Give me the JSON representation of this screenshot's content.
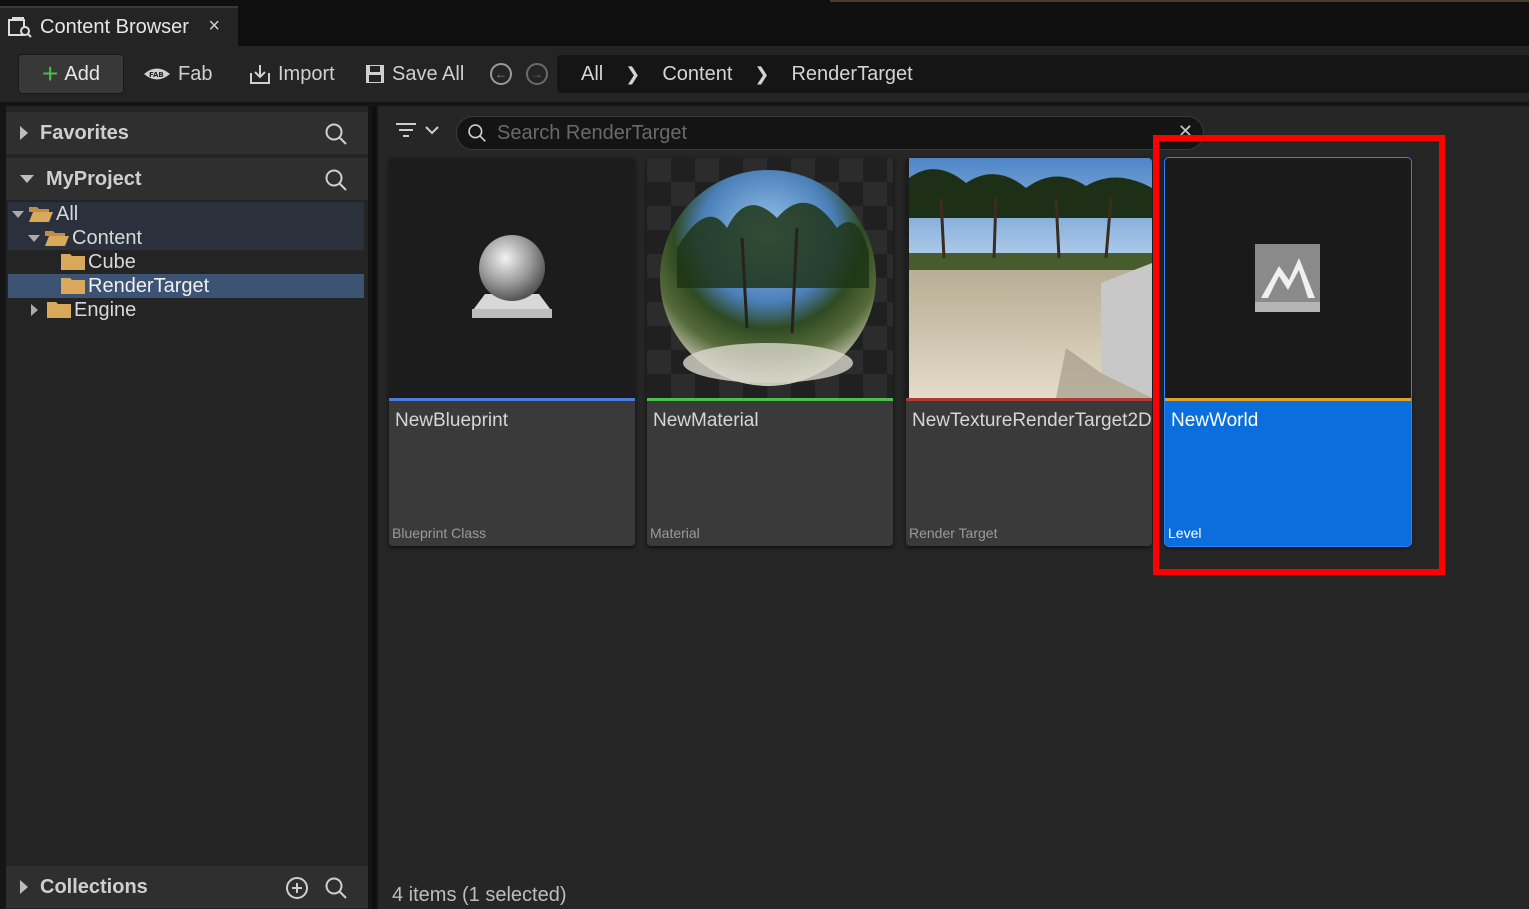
{
  "tab": {
    "title": "Content Browser",
    "close": "×",
    "icon": "content-browser-icon"
  },
  "toolbar": {
    "add_label": "Add",
    "fab_label": "Fab",
    "import_label": "Import",
    "save_all_label": "Save All",
    "back_icon": "back-arrow-icon",
    "forward_icon": "forward-arrow-icon"
  },
  "breadcrumb": [
    "All",
    "Content",
    "RenderTarget"
  ],
  "sidebar": {
    "favorites_label": "Favorites",
    "project_label": "MyProject",
    "collections_label": "Collections",
    "tree": [
      {
        "label": "All",
        "depth": 0,
        "expanded": true
      },
      {
        "label": "Content",
        "depth": 1,
        "expanded": true
      },
      {
        "label": "Cube",
        "depth": 2
      },
      {
        "label": "RenderTarget",
        "depth": 2,
        "selected": true
      },
      {
        "label": "Engine",
        "depth": 1,
        "expanded": false
      }
    ]
  },
  "search": {
    "placeholder": "Search RenderTarget"
  },
  "assets": [
    {
      "name": "NewBlueprint",
      "type": "Blueprint Class",
      "color": "#4a7be0"
    },
    {
      "name": "NewMaterial",
      "type": "Material",
      "color": "#4cc04c"
    },
    {
      "name": "NewTextureRenderTarget2D",
      "type": "Render Target",
      "color": "#b03a3a"
    },
    {
      "name": "NewWorld",
      "type": "Level",
      "color": "#e0a030",
      "selected": true
    }
  ],
  "status": {
    "text": "4 items (1 selected)"
  },
  "colors": {
    "selection": "#0a6fdd",
    "highlight_box": "#ff0000",
    "folder": "#d9a85a"
  }
}
